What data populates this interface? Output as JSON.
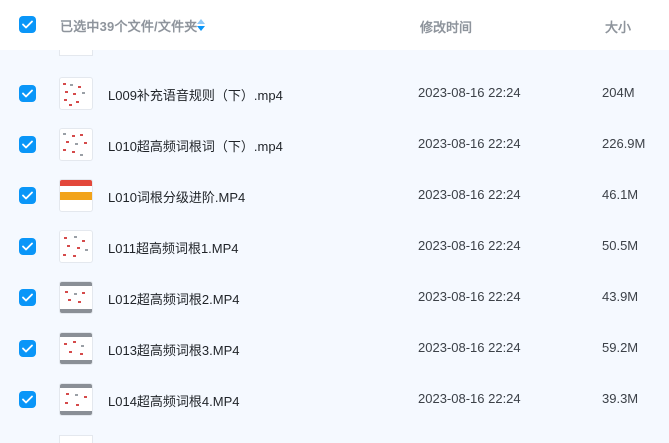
{
  "header": {
    "selected_label": "已选中39个文件/文件夹",
    "mtime_label": "修改时间",
    "size_label": "大小"
  },
  "files": [
    {
      "name": "L009补充语音规则（下）.mp4",
      "mtime": "2023-08-16 22:24",
      "size": "204M",
      "thumb": "red-notes"
    },
    {
      "name": "L010超高频词根词（下）.mp4",
      "mtime": "2023-08-16 22:24",
      "size": "226.9M",
      "thumb": "red-notes"
    },
    {
      "name": "L010词根分级进阶.MP4",
      "mtime": "2023-08-16 22:24",
      "size": "46.1M",
      "thumb": "orange-banner"
    },
    {
      "name": "L011超高频词根1.MP4",
      "mtime": "2023-08-16 22:24",
      "size": "50.5M",
      "thumb": "red-notes"
    },
    {
      "name": "L012超高频词根2.MP4",
      "mtime": "2023-08-16 22:24",
      "size": "43.9M",
      "thumb": "gray-banded"
    },
    {
      "name": "L013超高频词根3.MP4",
      "mtime": "2023-08-16 22:24",
      "size": "59.2M",
      "thumb": "gray-banded"
    },
    {
      "name": "L014超高频词根4.MP4",
      "mtime": "2023-08-16 22:24",
      "size": "39.3M",
      "thumb": "gray-banded"
    }
  ],
  "colors": {
    "accent": "#0a96f8",
    "header_text": "#8e949c",
    "row_background": "#f5f9ff"
  },
  "icons": {
    "checkbox": "check-icon",
    "sort": "sort-icon"
  }
}
